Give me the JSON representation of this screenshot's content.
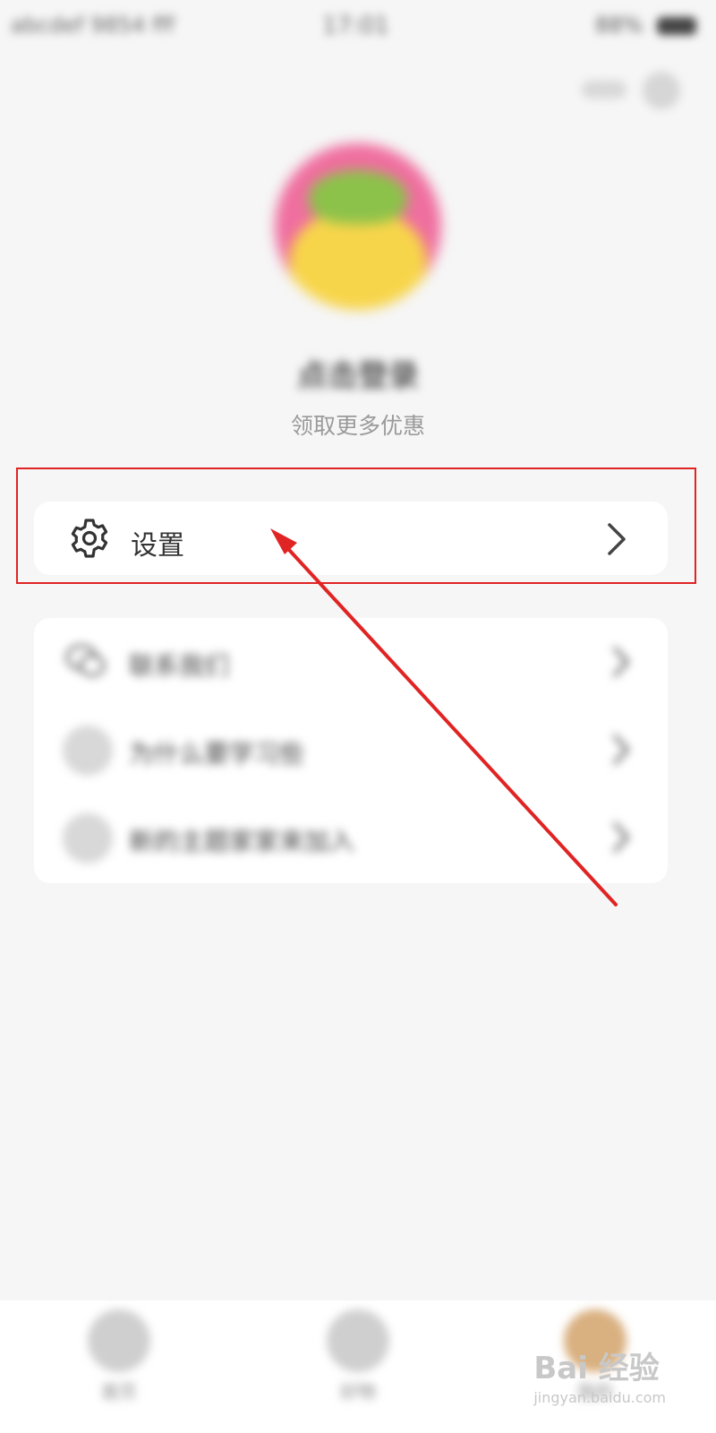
{
  "status_bar": {
    "left_text": "abcdef 9854 fff",
    "time": "17:01",
    "right_text": "88%"
  },
  "profile": {
    "login_title": "点击登录",
    "login_subtitle": "领取更多优惠"
  },
  "settings": {
    "label": "设置",
    "icon": "gear-icon",
    "chevron": "chevron-right-icon"
  },
  "list": {
    "items": [
      {
        "label": "联系我们",
        "icon": "wechat-icon"
      },
      {
        "label": "为什么要学习些",
        "icon": "user-circle-icon"
      },
      {
        "label": "新的主题家家来加入",
        "icon": "user-circle-icon"
      }
    ]
  },
  "tabbar": {
    "tabs": [
      {
        "label": "首页"
      },
      {
        "label": "好物"
      },
      {
        "label": "我的"
      }
    ]
  },
  "watermark": {
    "text": "Bai 经验",
    "url": "jingyan.baidu.com"
  },
  "colors": {
    "annotation": "#e02424",
    "background": "#f6f6f6",
    "card": "#ffffff"
  }
}
